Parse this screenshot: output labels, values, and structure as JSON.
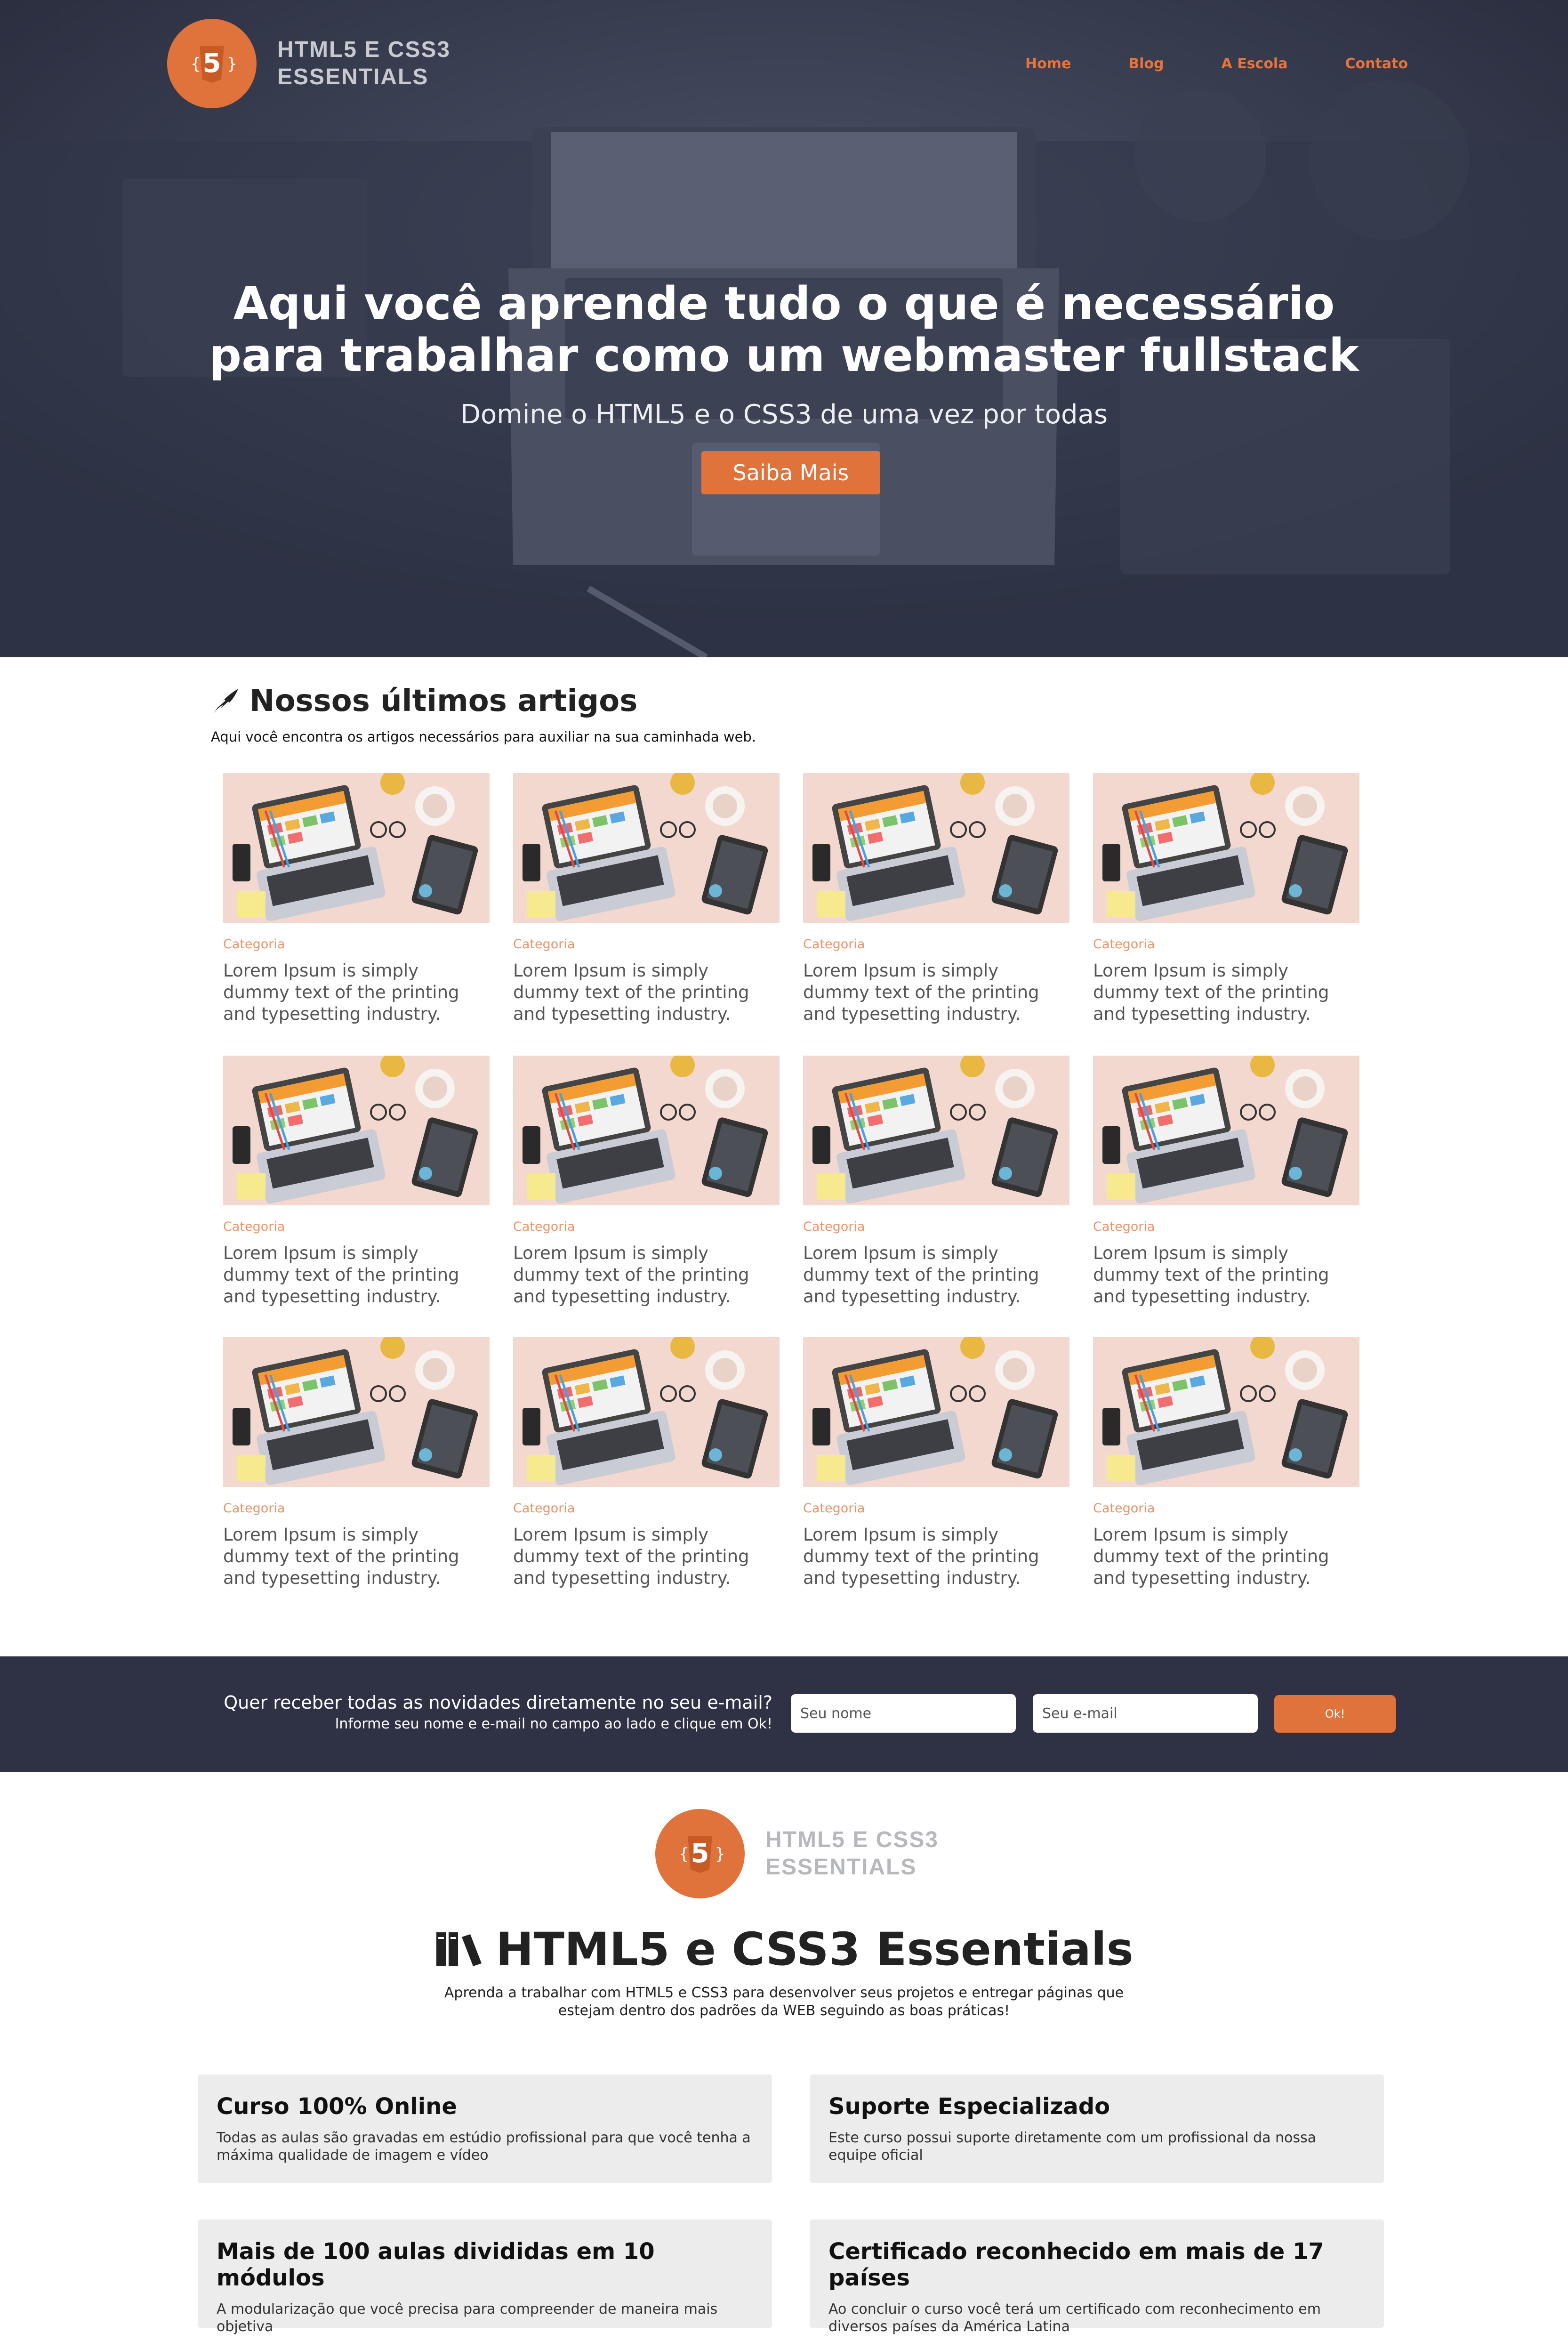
{
  "header": {
    "logo_line1": "HTML5 E CSS3",
    "logo_line2": "ESSENTIALS",
    "nav": [
      "Home",
      "Blog",
      "A Escola",
      "Contato"
    ]
  },
  "hero": {
    "title_line1": "Aqui você aprende tudo o que é necessário",
    "title_line2": "para trabalhar como um webmaster fullstack",
    "subtitle": "Domine o HTML5 e o CSS3 de uma vez por todas",
    "button": "Saiba Mais"
  },
  "articles": {
    "title": "Nossos últimos artigos",
    "description": "Aqui você encontra os artigos necessários para auxiliar na sua caminhada web.",
    "cards": [
      {
        "category": "Categoria",
        "text": "Lorem Ipsum is simply dummy text of the printing and typesetting industry."
      },
      {
        "category": "Categoria",
        "text": "Lorem Ipsum is simply dummy text of the printing and typesetting industry."
      },
      {
        "category": "Categoria",
        "text": "Lorem Ipsum is simply dummy text of the printing and typesetting industry."
      },
      {
        "category": "Categoria",
        "text": "Lorem Ipsum is simply dummy text of the printing and typesetting industry."
      },
      {
        "category": "Categoria",
        "text": "Lorem Ipsum is simply dummy text of the printing and typesetting industry."
      },
      {
        "category": "Categoria",
        "text": "Lorem Ipsum is simply dummy text of the printing and typesetting industry."
      },
      {
        "category": "Categoria",
        "text": "Lorem Ipsum is simply dummy text of the printing and typesetting industry."
      },
      {
        "category": "Categoria",
        "text": "Lorem Ipsum is simply dummy text of the printing and typesetting industry."
      },
      {
        "category": "Categoria",
        "text": "Lorem Ipsum is simply dummy text of the printing and typesetting industry."
      },
      {
        "category": "Categoria",
        "text": "Lorem Ipsum is simply dummy text of the printing and typesetting industry."
      },
      {
        "category": "Categoria",
        "text": "Lorem Ipsum is simply dummy text of the printing and typesetting industry."
      },
      {
        "category": "Categoria",
        "text": "Lorem Ipsum is simply dummy text of the printing and typesetting industry."
      }
    ]
  },
  "newsletter": {
    "question": "Quer receber todas as novidades diretamente no seu e-mail?",
    "instruction": "Informe seu nome e e-mail no campo ao lado e clique em Ok!",
    "name_placeholder": "Seu nome",
    "email_placeholder": "Seu e-mail",
    "button": "Ok!"
  },
  "school": {
    "logo_line1": "HTML5 E CSS3",
    "logo_line2": "ESSENTIALS",
    "title": "HTML5 e CSS3 Essentials",
    "description": "Aprenda a trabalhar com HTML5 e CSS3 para desenvolver seus projetos e entregar páginas que estejam dentro dos padrões da WEB seguindo as boas práticas!",
    "features": [
      {
        "title": "Curso 100% Online",
        "text": "Todas as aulas são gravadas em estúdio profissional para que você tenha a máxima qualidade de imagem e vídeo"
      },
      {
        "title": "Suporte Especializado",
        "text": "Este curso possui suporte diretamente com um profissional da nossa equipe oficial"
      },
      {
        "title": "Mais de 100 aulas divididas em 10 módulos",
        "text": "A modularização que você precisa para compreender de maneira mais objetiva"
      },
      {
        "title": "Certificado reconhecido em mais de 17 países",
        "text": "Ao concluir o curso você terá um certificado com reconhecimento em diversos países da América Latina"
      }
    ]
  },
  "colors": {
    "accent": "#e0723b",
    "dark": "#2e3244",
    "category": "#e8956a"
  }
}
